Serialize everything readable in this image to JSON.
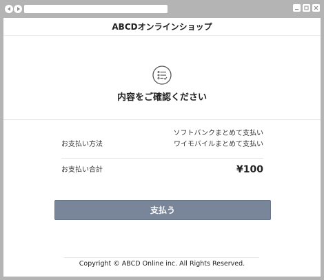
{
  "header": {
    "site_title": "ABCDオンラインショップ"
  },
  "confirm": {
    "icon": "checklist-icon",
    "title": "内容をご確認ください"
  },
  "payment": {
    "method_label": "お支払い方法",
    "methods": [
      "ソフトバンクまとめて支払い",
      "ワイモバイルまとめて支払い"
    ],
    "total_label": "お支払い合計",
    "total_amount": "¥100"
  },
  "actions": {
    "pay_label": "支払う"
  },
  "footer": {
    "copyright": "Copyright © ABCD Online inc. All Rights Reserved."
  },
  "colors": {
    "chrome_bg": "#b4b4b4",
    "pay_button": "#79869a",
    "content_bg": "#ffffff"
  }
}
